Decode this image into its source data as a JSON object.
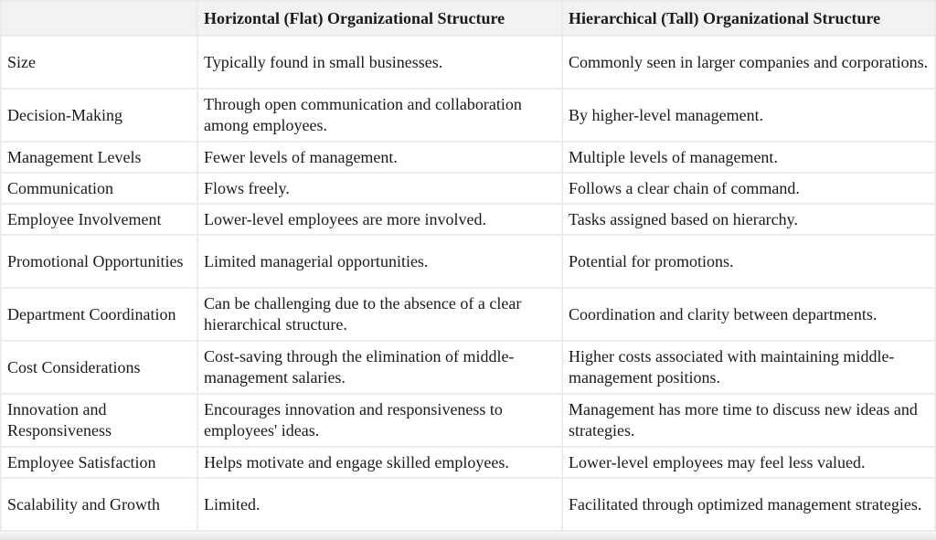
{
  "table": {
    "headers": [
      "",
      "Horizontal (Flat) Organizational Structure",
      "Hierarchical (Tall) Organizational Structure"
    ],
    "rows": [
      {
        "aspect": "Size",
        "flat": "Typically found in small businesses.",
        "tall": "Commonly seen in larger companies and corporations."
      },
      {
        "aspect": "Decision-Making",
        "flat": "Through open communication and collaboration among employees.",
        "tall": "By higher-level management."
      },
      {
        "aspect": "Management Levels",
        "flat": "Fewer levels of management.",
        "tall": "Multiple levels of management."
      },
      {
        "aspect": "Communication",
        "flat": "Flows freely.",
        "tall": "Follows a clear chain of command."
      },
      {
        "aspect": "Employee Involvement",
        "flat": "Lower-level employees are more involved.",
        "tall": "Tasks assigned based on hierarchy."
      },
      {
        "aspect": "Promotional Opportunities",
        "flat": "Limited managerial opportunities.",
        "tall": "Potential for promotions."
      },
      {
        "aspect": "Department Coordination",
        "flat": "Can be challenging due to the absence of a clear hierarchical structure.",
        "tall": "Coordination and clarity between departments."
      },
      {
        "aspect": "Cost Considerations",
        "flat": "Cost-saving through the elimination of middle-management salaries.",
        "tall": "Higher costs associated with maintaining middle-management positions."
      },
      {
        "aspect": "Innovation and Responsiveness",
        "flat": "Encourages innovation and responsiveness to employees' ideas.",
        "tall": "Management has more time to discuss new ideas and strategies."
      },
      {
        "aspect": "Employee Satisfaction",
        "flat": "Helps motivate and engage skilled employees.",
        "tall": "Lower-level employees may feel less valued."
      },
      {
        "aspect": "Scalability and Growth",
        "flat": "Limited.",
        "tall": "Facilitated through optimized management strategies."
      }
    ]
  },
  "colors": {
    "header_bg": "#f2f2f2",
    "border": "#ececec",
    "text": "#1a1a1a"
  }
}
